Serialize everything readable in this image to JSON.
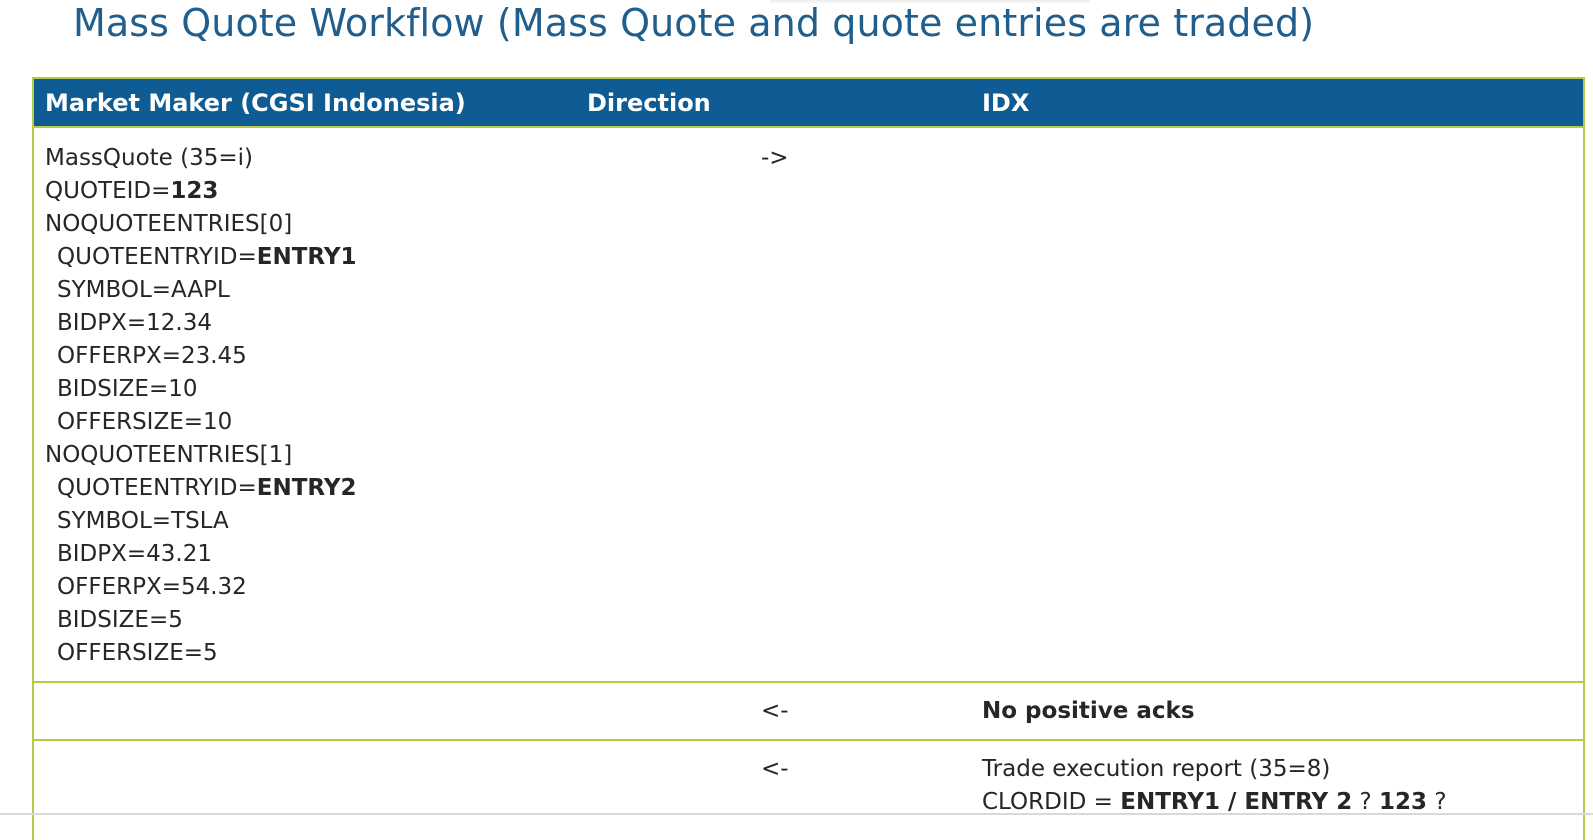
{
  "title": "Mass Quote Workflow (Mass Quote and quote entries are traded)",
  "table": {
    "headers": {
      "market_maker": "Market Maker (CGSI Indonesia)",
      "direction": "Direction",
      "idx": "IDX"
    },
    "row1": {
      "direction": "->",
      "lines": {
        "l0": "MassQuote (35=i)",
        "l1_prefix": "QUOTEID=",
        "l1_bold": "123",
        "l2": "NOQUOTEENTRIES[0]",
        "l3_prefix": "QUOTEENTRYID=",
        "l3_bold": "ENTRY1",
        "l4": "SYMBOL=AAPL",
        "l5": "BIDPX=12.34",
        "l6": "OFFERPX=23.45",
        "l7": "BIDSIZE=10",
        "l8": "OFFERSIZE=10",
        "l9": "NOQUOTEENTRIES[1]",
        "l10_prefix": "QUOTEENTRYID=",
        "l10_bold": "ENTRY2",
        "l11": "SYMBOL=TSLA",
        "l12": "BIDPX=43.21",
        "l13": "OFFERPX=54.32",
        "l14": "BIDSIZE=5",
        "l15": "OFFERSIZE=5"
      }
    },
    "row2": {
      "direction": "<-",
      "idx": "No positive acks"
    },
    "row3": {
      "direction": "<-",
      "idx_line1": "Trade execution report (35=8)",
      "idx_line2_prefix": "CLORDID = ",
      "idx_line2_bold1": "ENTRY1 / ENTRY 2",
      "idx_line2_mid": " ? ",
      "idx_line2_bold2": "123",
      "idx_line2_suffix": "  ?"
    }
  },
  "colors": {
    "title": "#1f5e8d",
    "header_bg": "#0f5b93",
    "border": "#b5c94a"
  }
}
